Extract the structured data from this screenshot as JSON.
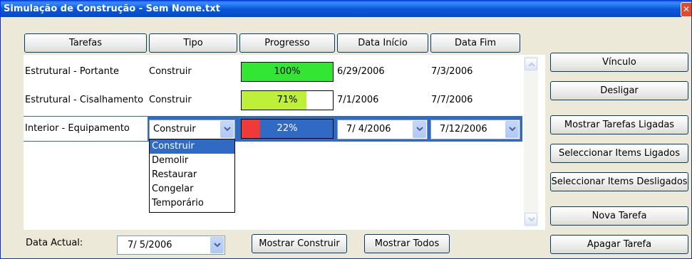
{
  "window": {
    "title": "Simulação de Construção - Sem Nome.txt"
  },
  "columns": [
    "Tarefas",
    "Tipo",
    "Progresso",
    "Data Início",
    "Data Fim"
  ],
  "rows": [
    {
      "tarefa": "Estrutural - Portante",
      "tipo": "Construir",
      "progress_label": "100%",
      "progress": 100,
      "fill_color": "#33e633",
      "inicio": "6/29/2006",
      "fim": "7/3/2006"
    },
    {
      "tarefa": "Estrutural - Cisalhamento",
      "tipo": "Construir",
      "progress_label": "71%",
      "progress": 71,
      "fill_color": "#bff039",
      "inicio": "7/1/2006",
      "fim": "7/7/2006"
    },
    {
      "tarefa": "Interior - Equipamento",
      "tipo": "Construir",
      "progress_label": "22%",
      "progress": 22,
      "fill_color": "#f03a3a",
      "inicio": "7/ 4/2006",
      "fim": "7/12/2006"
    }
  ],
  "tipo_options": [
    "Construir",
    "Demolir",
    "Restaurar",
    "Congelar",
    "Temporário"
  ],
  "side_buttons": [
    "Vínculo",
    "Desligar",
    "Mostrar Tarefas Ligadas",
    "Seleccionar Items Ligados",
    "Seleccionar Items Desligados",
    "Nova Tarefa",
    "Apagar Tarefa"
  ],
  "footer": {
    "date_label": "Data Actual:",
    "date_value": "7/ 5/2006",
    "show_build": "Mostrar Construir",
    "show_all": "Mostrar Todos"
  },
  "colors": {
    "selection": "#316ac5",
    "title_bar": "#0a58d8"
  }
}
